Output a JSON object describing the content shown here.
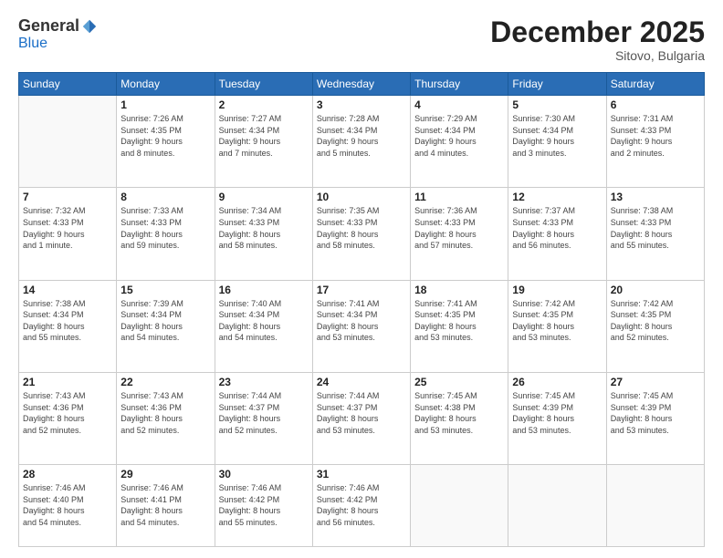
{
  "logo": {
    "general": "General",
    "blue": "Blue"
  },
  "header": {
    "title": "December 2025",
    "location": "Sitovo, Bulgaria"
  },
  "weekdays": [
    "Sunday",
    "Monday",
    "Tuesday",
    "Wednesday",
    "Thursday",
    "Friday",
    "Saturday"
  ],
  "days": [
    {
      "num": "",
      "info": ""
    },
    {
      "num": "1",
      "info": "Sunrise: 7:26 AM\nSunset: 4:35 PM\nDaylight: 9 hours\nand 8 minutes."
    },
    {
      "num": "2",
      "info": "Sunrise: 7:27 AM\nSunset: 4:34 PM\nDaylight: 9 hours\nand 7 minutes."
    },
    {
      "num": "3",
      "info": "Sunrise: 7:28 AM\nSunset: 4:34 PM\nDaylight: 9 hours\nand 5 minutes."
    },
    {
      "num": "4",
      "info": "Sunrise: 7:29 AM\nSunset: 4:34 PM\nDaylight: 9 hours\nand 4 minutes."
    },
    {
      "num": "5",
      "info": "Sunrise: 7:30 AM\nSunset: 4:34 PM\nDaylight: 9 hours\nand 3 minutes."
    },
    {
      "num": "6",
      "info": "Sunrise: 7:31 AM\nSunset: 4:33 PM\nDaylight: 9 hours\nand 2 minutes."
    },
    {
      "num": "7",
      "info": "Sunrise: 7:32 AM\nSunset: 4:33 PM\nDaylight: 9 hours\nand 1 minute."
    },
    {
      "num": "8",
      "info": "Sunrise: 7:33 AM\nSunset: 4:33 PM\nDaylight: 8 hours\nand 59 minutes."
    },
    {
      "num": "9",
      "info": "Sunrise: 7:34 AM\nSunset: 4:33 PM\nDaylight: 8 hours\nand 58 minutes."
    },
    {
      "num": "10",
      "info": "Sunrise: 7:35 AM\nSunset: 4:33 PM\nDaylight: 8 hours\nand 58 minutes."
    },
    {
      "num": "11",
      "info": "Sunrise: 7:36 AM\nSunset: 4:33 PM\nDaylight: 8 hours\nand 57 minutes."
    },
    {
      "num": "12",
      "info": "Sunrise: 7:37 AM\nSunset: 4:33 PM\nDaylight: 8 hours\nand 56 minutes."
    },
    {
      "num": "13",
      "info": "Sunrise: 7:38 AM\nSunset: 4:33 PM\nDaylight: 8 hours\nand 55 minutes."
    },
    {
      "num": "14",
      "info": "Sunrise: 7:38 AM\nSunset: 4:34 PM\nDaylight: 8 hours\nand 55 minutes."
    },
    {
      "num": "15",
      "info": "Sunrise: 7:39 AM\nSunset: 4:34 PM\nDaylight: 8 hours\nand 54 minutes."
    },
    {
      "num": "16",
      "info": "Sunrise: 7:40 AM\nSunset: 4:34 PM\nDaylight: 8 hours\nand 54 minutes."
    },
    {
      "num": "17",
      "info": "Sunrise: 7:41 AM\nSunset: 4:34 PM\nDaylight: 8 hours\nand 53 minutes."
    },
    {
      "num": "18",
      "info": "Sunrise: 7:41 AM\nSunset: 4:35 PM\nDaylight: 8 hours\nand 53 minutes."
    },
    {
      "num": "19",
      "info": "Sunrise: 7:42 AM\nSunset: 4:35 PM\nDaylight: 8 hours\nand 53 minutes."
    },
    {
      "num": "20",
      "info": "Sunrise: 7:42 AM\nSunset: 4:35 PM\nDaylight: 8 hours\nand 52 minutes."
    },
    {
      "num": "21",
      "info": "Sunrise: 7:43 AM\nSunset: 4:36 PM\nDaylight: 8 hours\nand 52 minutes."
    },
    {
      "num": "22",
      "info": "Sunrise: 7:43 AM\nSunset: 4:36 PM\nDaylight: 8 hours\nand 52 minutes."
    },
    {
      "num": "23",
      "info": "Sunrise: 7:44 AM\nSunset: 4:37 PM\nDaylight: 8 hours\nand 52 minutes."
    },
    {
      "num": "24",
      "info": "Sunrise: 7:44 AM\nSunset: 4:37 PM\nDaylight: 8 hours\nand 53 minutes."
    },
    {
      "num": "25",
      "info": "Sunrise: 7:45 AM\nSunset: 4:38 PM\nDaylight: 8 hours\nand 53 minutes."
    },
    {
      "num": "26",
      "info": "Sunrise: 7:45 AM\nSunset: 4:39 PM\nDaylight: 8 hours\nand 53 minutes."
    },
    {
      "num": "27",
      "info": "Sunrise: 7:45 AM\nSunset: 4:39 PM\nDaylight: 8 hours\nand 53 minutes."
    },
    {
      "num": "28",
      "info": "Sunrise: 7:46 AM\nSunset: 4:40 PM\nDaylight: 8 hours\nand 54 minutes."
    },
    {
      "num": "29",
      "info": "Sunrise: 7:46 AM\nSunset: 4:41 PM\nDaylight: 8 hours\nand 54 minutes."
    },
    {
      "num": "30",
      "info": "Sunrise: 7:46 AM\nSunset: 4:42 PM\nDaylight: 8 hours\nand 55 minutes."
    },
    {
      "num": "31",
      "info": "Sunrise: 7:46 AM\nSunset: 4:42 PM\nDaylight: 8 hours\nand 56 minutes."
    },
    {
      "num": "",
      "info": ""
    },
    {
      "num": "",
      "info": ""
    },
    {
      "num": "",
      "info": ""
    }
  ]
}
